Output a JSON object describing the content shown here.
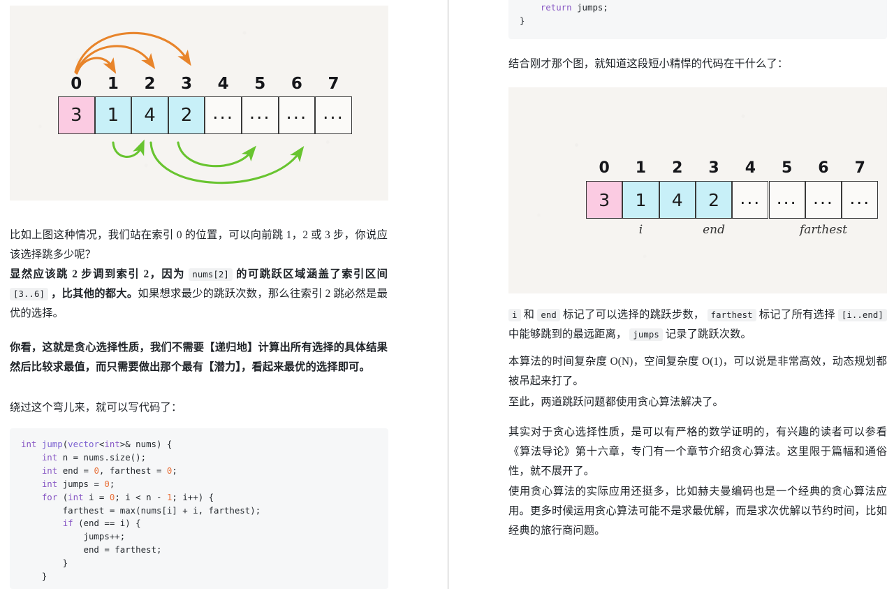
{
  "colors": {
    "paper": "#f6f4f1",
    "cell_pink": "#fbcbe2",
    "cell_cyan": "#c8f0f8",
    "arrow_orange": "#e8842a",
    "arrow_green": "#68c430",
    "code_bg": "#f6f7f8",
    "text": "#1f2328",
    "divider": "#b9b9b9"
  },
  "left_column": {
    "figure": {
      "name": "jump-game-choices-diagram",
      "indices": [
        "0",
        "1",
        "2",
        "3",
        "4",
        "5",
        "6",
        "7"
      ],
      "cells": [
        {
          "value": "3",
          "fill": "pink"
        },
        {
          "value": "1",
          "fill": "cyan"
        },
        {
          "value": "4",
          "fill": "cyan"
        },
        {
          "value": "2",
          "fill": "cyan"
        },
        {
          "value": "...",
          "fill": "plain"
        },
        {
          "value": "...",
          "fill": "plain"
        },
        {
          "value": "...",
          "fill": "plain"
        },
        {
          "value": "...",
          "fill": "plain"
        }
      ],
      "orange_arrows": [
        {
          "from": 0,
          "to": 1
        },
        {
          "from": 0,
          "to": 2
        },
        {
          "from": 0,
          "to": 3
        }
      ],
      "green_arrows": [
        {
          "from": 1,
          "to": 2
        },
        {
          "from": 3,
          "to": 5
        },
        {
          "from": 2,
          "to": 6
        }
      ]
    },
    "paragraphs": {
      "p1": "比如上图这种情况，我们站在索引 0 的位置，可以向前跳 1，2 或 3 步，你说应该选择跳多少呢？",
      "p2_a": "显然应该跳 2 步调到索引 2，因为",
      "p2_code1": "nums[2]",
      "p2_b": "的可跳跃区域涵盖了索引区间",
      "p2_code2": "[3..6]",
      "p2_c": "，比其他的都大。",
      "p2_d": "如果想求最少的跳跃次数，那么往索引 2 跳必然是最优的选择。",
      "p3": "你看，这就是贪心选择性质，我们不需要【递归地】计算出所有选择的具体结果然后比较求最值，而只需要做出那个最有【潜力】，看起来最优的选择即可。",
      "p4": "绕过这个弯儿来，就可以写代码了："
    },
    "code": {
      "lines": [
        [
          {
            "t": "int",
            "c": "k-type"
          },
          {
            "t": " ",
            "c": "k-plain"
          },
          {
            "t": "jump",
            "c": "k-fn"
          },
          {
            "t": "(",
            "c": "k-plain"
          },
          {
            "t": "vector",
            "c": "k-fn"
          },
          {
            "t": "<",
            "c": "k-plain"
          },
          {
            "t": "int",
            "c": "k-type"
          },
          {
            "t": ">& nums) {",
            "c": "k-plain"
          }
        ],
        [
          {
            "t": "    ",
            "c": "k-plain"
          },
          {
            "t": "int",
            "c": "k-type"
          },
          {
            "t": " n = nums.size();",
            "c": "k-plain"
          }
        ],
        [
          {
            "t": "    ",
            "c": "k-plain"
          },
          {
            "t": "int",
            "c": "k-type"
          },
          {
            "t": " end = ",
            "c": "k-plain"
          },
          {
            "t": "0",
            "c": "k-num"
          },
          {
            "t": ", farthest = ",
            "c": "k-plain"
          },
          {
            "t": "0",
            "c": "k-num"
          },
          {
            "t": ";",
            "c": "k-plain"
          }
        ],
        [
          {
            "t": "    ",
            "c": "k-plain"
          },
          {
            "t": "int",
            "c": "k-type"
          },
          {
            "t": " jumps = ",
            "c": "k-plain"
          },
          {
            "t": "0",
            "c": "k-num"
          },
          {
            "t": ";",
            "c": "k-plain"
          }
        ],
        [
          {
            "t": "    ",
            "c": "k-plain"
          },
          {
            "t": "for",
            "c": "k-type"
          },
          {
            "t": " (",
            "c": "k-plain"
          },
          {
            "t": "int",
            "c": "k-type"
          },
          {
            "t": " i = ",
            "c": "k-plain"
          },
          {
            "t": "0",
            "c": "k-num"
          },
          {
            "t": "; i < n - ",
            "c": "k-plain"
          },
          {
            "t": "1",
            "c": "k-num"
          },
          {
            "t": "; i++) {",
            "c": "k-plain"
          }
        ],
        [
          {
            "t": "        farthest = max(nums[i] + i, farthest);",
            "c": "k-plain"
          }
        ],
        [
          {
            "t": "        ",
            "c": "k-plain"
          },
          {
            "t": "if",
            "c": "k-type"
          },
          {
            "t": " (end == i) {",
            "c": "k-plain"
          }
        ],
        [
          {
            "t": "            jumps++;",
            "c": "k-plain"
          }
        ],
        [
          {
            "t": "            end = farthest;",
            "c": "k-plain"
          }
        ],
        [
          {
            "t": "        }",
            "c": "k-plain"
          }
        ],
        [
          {
            "t": "    }",
            "c": "k-plain"
          }
        ]
      ]
    }
  },
  "right_column": {
    "code_top": {
      "lines": [
        [
          {
            "t": "    ",
            "c": "k-plain"
          },
          {
            "t": "return",
            "c": "k-type"
          },
          {
            "t": " jumps;",
            "c": "k-plain"
          }
        ],
        [
          {
            "t": "}",
            "c": "k-plain"
          }
        ]
      ]
    },
    "paragraphs": {
      "p1": "结合刚才那个图，就知道这段短小精悍的代码在干什么了：",
      "p2_code1": "i",
      "p2_a": "和",
      "p2_code2": "end",
      "p2_b": "标记了可以选择的跳跃步数，",
      "p2_code3": "farthest",
      "p2_c": "标记了所有选择",
      "p2_code4": "[i..end]",
      "p2_d": "中能够跳到的最远距离，",
      "p2_code5": "jumps",
      "p2_e": "记录了跳跃次数。",
      "p3": "本算法的时间复杂度 O(N)，空间复杂度 O(1)，可以说是非常高效，动态规划都被吊起来打了。",
      "p4": "至此，两道跳跃问题都使用贪心算法解决了。",
      "p5": "其实对于贪心选择性质，是可以有严格的数学证明的，有兴趣的读者可以参看《算法导论》第十六章，专门有一个章节介绍贪心算法。这里限于篇幅和通俗性，就不展开了。",
      "p6": "使用贪心算法的实际应用还挺多，比如赫夫曼编码也是一个经典的贪心算法应用。更多时候运用贪心算法可能不是求最优解，而是求次优解以节约时间，比如经典的旅行商问题。"
    },
    "figure": {
      "name": "jump-game-pointers-diagram",
      "indices": [
        "0",
        "1",
        "2",
        "3",
        "4",
        "5",
        "6",
        "7"
      ],
      "cells": [
        {
          "value": "3",
          "fill": "pink"
        },
        {
          "value": "1",
          "fill": "cyan"
        },
        {
          "value": "4",
          "fill": "cyan"
        },
        {
          "value": "2",
          "fill": "cyan"
        },
        {
          "value": "...",
          "fill": "plain"
        },
        {
          "value": "...",
          "fill": "plain"
        },
        {
          "value": "...",
          "fill": "plain"
        },
        {
          "value": "...",
          "fill": "plain"
        }
      ],
      "pointer_labels": [
        {
          "text": "i",
          "index": 1
        },
        {
          "text": "end",
          "index": 3
        },
        {
          "text": "farthest",
          "index": 6
        }
      ]
    }
  }
}
